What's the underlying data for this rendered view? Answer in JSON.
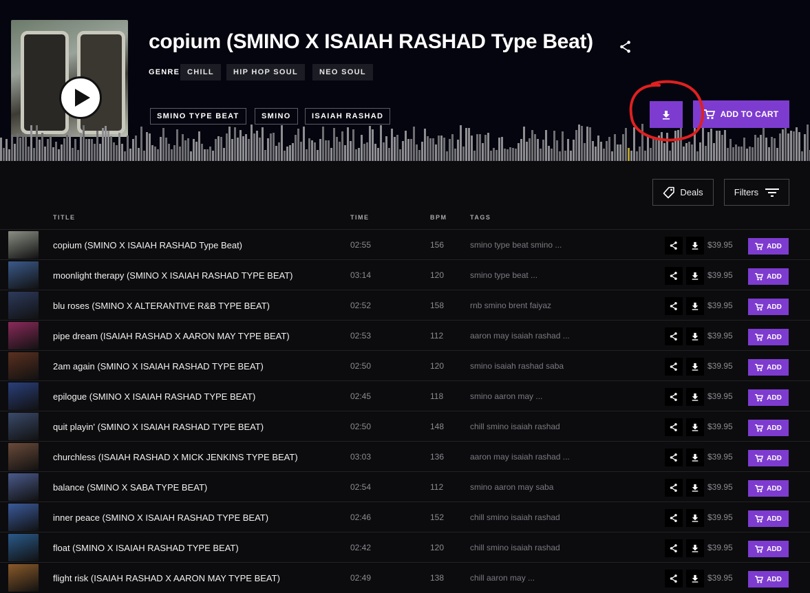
{
  "beat": {
    "title": "copium (SMINO X ISAIAH RASHAD Type Beat)",
    "genre_label": "GENRE",
    "genres": [
      "CHILL",
      "HIP HOP SOUL",
      "NEO SOUL"
    ],
    "tags": [
      "SMINO TYPE BEAT",
      "SMINO",
      "ISAIAH RASHAD"
    ],
    "add_to_cart_label": "ADD TO CART"
  },
  "toolbar": {
    "deals_label": "Deals",
    "filters_label": "Filters"
  },
  "table": {
    "headers": {
      "title": "TITLE",
      "time": "TIME",
      "bpm": "BPM",
      "tags": "TAGS"
    },
    "add_label": "ADD",
    "rows": [
      {
        "title": "copium (SMINO X ISAIAH RASHAD Type Beat)",
        "time": "02:55",
        "bpm": "156",
        "tags": "smino type beat  smino ...",
        "price": "$39.95",
        "thumb_color": "#8a8f84"
      },
      {
        "title": "moonlight therapy (SMINO X ISAIAH RASHAD TYPE BEAT)",
        "time": "03:14",
        "bpm": "120",
        "tags": "smino type beat ...",
        "price": "$39.95",
        "thumb_color": "#3b5a8a"
      },
      {
        "title": "blu roses (SMINO X ALTERANTIVE R&B TYPE BEAT)",
        "time": "02:52",
        "bpm": "158",
        "tags": "rnb  smino  brent faiyaz",
        "price": "$39.95",
        "thumb_color": "#2d3a5c"
      },
      {
        "title": "pipe dream (ISAIAH RASHAD X AARON MAY TYPE BEAT)",
        "time": "02:53",
        "bpm": "112",
        "tags": "aaron may  isaiah rashad ...",
        "price": "$39.95",
        "thumb_color": "#8a2a5a"
      },
      {
        "title": "2am again (SMINO X ISAIAH RASHAD TYPE BEAT)",
        "time": "02:50",
        "bpm": "120",
        "tags": "smino  isaiah rashad  saba",
        "price": "$39.95",
        "thumb_color": "#5a3020"
      },
      {
        "title": "epilogue (SMINO X ISAIAH RASHAD TYPE BEAT)",
        "time": "02:45",
        "bpm": "118",
        "tags": "smino  aaron may ...",
        "price": "$39.95",
        "thumb_color": "#2a3f7a"
      },
      {
        "title": "quit playin' (SMINO X ISAIAH RASHAD TYPE BEAT)",
        "time": "02:50",
        "bpm": "148",
        "tags": "chill  smino  isaiah rashad",
        "price": "$39.95",
        "thumb_color": "#3a4a6a"
      },
      {
        "title": "churchless (ISAIAH RASHAD X MICK JENKINS TYPE BEAT)",
        "time": "03:03",
        "bpm": "136",
        "tags": "aaron may  isaiah rashad ...",
        "price": "$39.95",
        "thumb_color": "#6a4a3a"
      },
      {
        "title": "balance (SMINO X SABA TYPE BEAT)",
        "time": "02:54",
        "bpm": "112",
        "tags": "smino  aaron may  saba",
        "price": "$39.95",
        "thumb_color": "#4a5a8a"
      },
      {
        "title": "inner peace (SMINO X ISAIAH RASHAD TYPE BEAT)",
        "time": "02:46",
        "bpm": "152",
        "tags": "chill  smino  isaiah rashad",
        "price": "$39.95",
        "thumb_color": "#3a5a9a"
      },
      {
        "title": "float (SMINO X ISAIAH RASHAD TYPE BEAT)",
        "time": "02:42",
        "bpm": "120",
        "tags": "chill  smino  isaiah rashad",
        "price": "$39.95",
        "thumb_color": "#2a5a8a"
      },
      {
        "title": "flight risk (ISAIAH RASHAD X AARON MAY TYPE BEAT)",
        "time": "02:49",
        "bpm": "138",
        "tags": "chill  aaron may ...",
        "price": "$39.95",
        "thumb_color": "#8a5a2a"
      }
    ]
  },
  "colors": {
    "accent": "#7d3ccf",
    "background": "#0c0c0e",
    "hero": "#05050f",
    "annotation": "#e02020"
  },
  "icons": {
    "play": "play-icon",
    "share": "share-icon",
    "download": "download-icon",
    "cart": "cart-icon",
    "tag": "tag-icon",
    "filter": "filter-icon"
  }
}
